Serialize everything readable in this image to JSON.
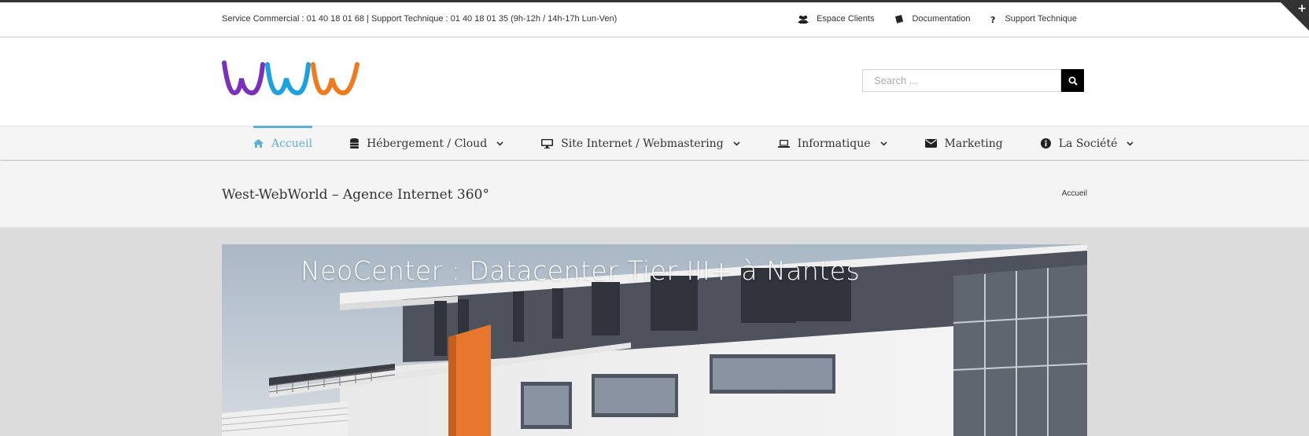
{
  "topbar": {
    "contact": "Service Commercial : 01 40 18 01 68 | Support Technique : 01 40 18 01 35 (9h-12h / 14h-17h Lun-Ven)",
    "links": [
      {
        "label": "Espace Clients",
        "icon": "users-icon"
      },
      {
        "label": "Documentation",
        "icon": "book-icon"
      },
      {
        "label": "Support Technique",
        "icon": "question-icon"
      }
    ],
    "corner_symbol": "+"
  },
  "header": {
    "logo": "WWW",
    "search_placeholder": "Search ..."
  },
  "nav": {
    "items": [
      {
        "label": "Accueil",
        "icon": "home-icon",
        "active": true,
        "dropdown": false
      },
      {
        "label": "Hébergement / Cloud",
        "icon": "database-icon",
        "active": false,
        "dropdown": true
      },
      {
        "label": "Site Internet / Webmastering",
        "icon": "desktop-icon",
        "active": false,
        "dropdown": true
      },
      {
        "label": "Informatique",
        "icon": "laptop-icon",
        "active": false,
        "dropdown": true
      },
      {
        "label": "Marketing",
        "icon": "envelope-icon",
        "active": false,
        "dropdown": false
      },
      {
        "label": "La Société",
        "icon": "info-icon",
        "active": false,
        "dropdown": true
      }
    ]
  },
  "page": {
    "title": "West-WebWorld – Agence Internet 360°",
    "breadcrumb": "Accueil"
  },
  "hero": {
    "title": "NeoCenter : Datacenter Tier III+ à Nantes"
  },
  "colors": {
    "accent": "#5fb0d6",
    "logo_purple": "#7b2fbe",
    "logo_blue": "#1aa3e0",
    "logo_orange": "#f07a1c",
    "building_orange": "#e8772e"
  }
}
